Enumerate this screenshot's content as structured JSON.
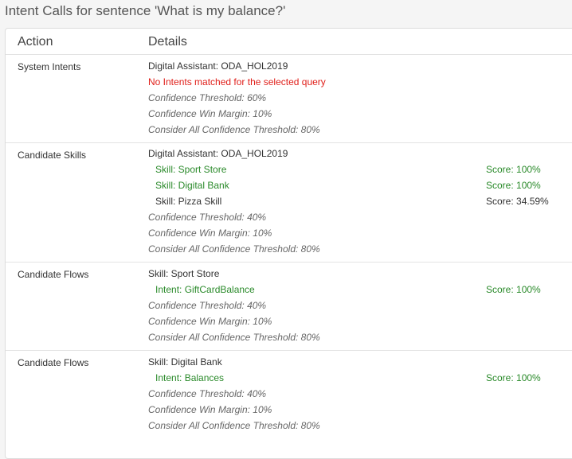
{
  "title": "Intent Calls for sentence 'What is my balance?'",
  "header": {
    "action": "Action",
    "details": "Details"
  },
  "sections": [
    {
      "action": "System Intents",
      "lines": [
        "Digital Assistant: ODA_HOL2019",
        "No Intents matched for the selected query",
        "Confidence Threshold: 60%",
        "Confidence Win Margin: 10%",
        "Consider All Confidence Threshold: 80%"
      ]
    },
    {
      "action": "Candidate Skills",
      "lines": [
        "Digital Assistant: ODA_HOL2019",
        "Skill: Sport Store",
        "Skill: Digital Bank",
        "Skill: Pizza Skill",
        "Confidence Threshold: 40%",
        "Confidence Win Margin: 10%",
        "Consider All Confidence Threshold: 80%"
      ],
      "scores": [
        "Score: 100%",
        "Score: 100%",
        "Score: 34.59%"
      ]
    },
    {
      "action": "Candidate Flows",
      "lines": [
        "Skill: Sport Store",
        "Intent: GiftCardBalance",
        "Confidence Threshold: 40%",
        "Confidence Win Margin: 10%",
        "Consider All Confidence Threshold: 80%"
      ],
      "scores": [
        "Score: 100%"
      ]
    },
    {
      "action": "Candidate Flows",
      "lines": [
        "Skill: Digital Bank",
        "Intent: Balances",
        "Confidence Threshold: 40%",
        "Confidence Win Margin: 10%",
        "Consider All Confidence Threshold: 80%"
      ],
      "scores": [
        "Score: 100%"
      ]
    }
  ],
  "colors": {
    "matched": "#2a8a2a",
    "error": "#e0201b",
    "muted": "#666666"
  }
}
